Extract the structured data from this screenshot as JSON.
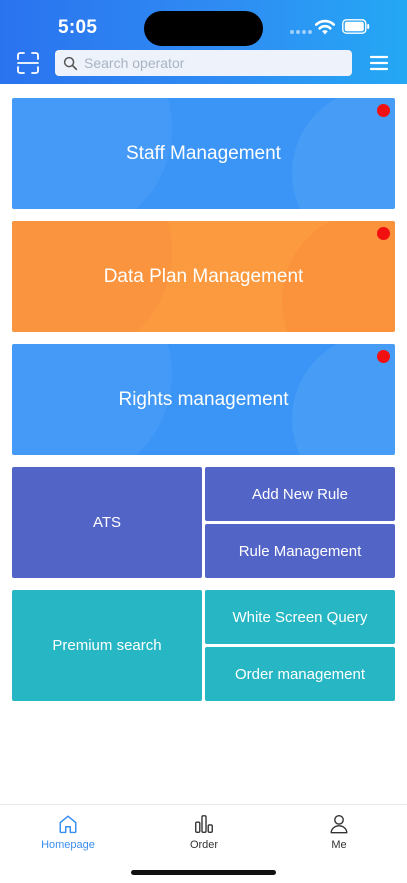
{
  "status_bar": {
    "time": "5:05"
  },
  "search": {
    "placeholder": "Search operator"
  },
  "tiles": {
    "staff": {
      "label": "Staff Management"
    },
    "data_plan": {
      "label": "Data Plan Management"
    },
    "rights": {
      "label": "Rights management"
    },
    "ats": {
      "label": "ATS"
    },
    "add_rule": {
      "label": "Add New Rule"
    },
    "rule_mgmt": {
      "label": "Rule Management"
    },
    "premium": {
      "label": "Premium search"
    },
    "white_screen": {
      "label": "White Screen Query"
    },
    "order_mgmt": {
      "label": "Order management"
    }
  },
  "tabbar": {
    "items": [
      {
        "label": "Homepage",
        "icon": "home-icon",
        "active": true
      },
      {
        "label": "Order",
        "icon": "bar-chart-icon",
        "active": false
      },
      {
        "label": "Me",
        "icon": "person-icon",
        "active": false
      }
    ]
  },
  "colors": {
    "header_start": "#2a73ef",
    "header_end": "#24a8f4",
    "tile_blue": "#3a95f6",
    "tile_orange": "#fb9a3f",
    "tile_indigo": "#5364c7",
    "tile_teal": "#27b6c3",
    "notification_dot": "#f20f0f",
    "tab_active": "#3a8ef0"
  }
}
